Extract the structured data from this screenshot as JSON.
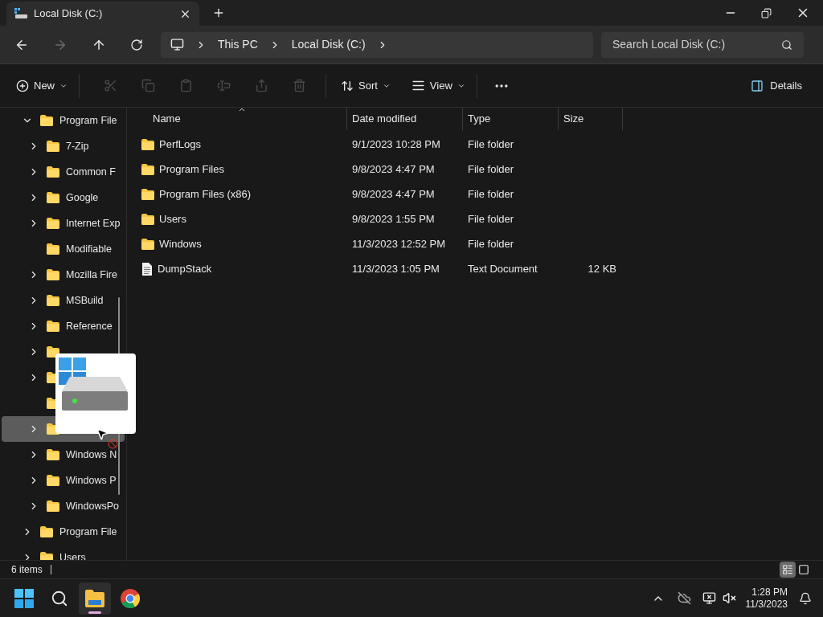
{
  "window": {
    "tabs": [
      {
        "title": "Local Disk (C:)",
        "selected": true
      }
    ]
  },
  "address": {
    "crumbs": [
      "This PC",
      "Local Disk (C:)"
    ]
  },
  "search": {
    "placeholder": "Search Local Disk (C:)"
  },
  "toolbar": {
    "new_label": "New",
    "actions": [
      {
        "disabled": true
      },
      {
        "disabled": true
      },
      {
        "disabled": true
      },
      {
        "disabled": true
      },
      {
        "disabled": true
      },
      {
        "disabled": true
      }
    ],
    "sort_label": "Sort",
    "view_label": "View",
    "details_label": "Details"
  },
  "tree": [
    {
      "label": "Program File",
      "expandable": true,
      "expanded": true,
      "selected": false,
      "children": [
        {
          "label": "7-Zip",
          "expandable": true,
          "expanded": false,
          "selected": false
        },
        {
          "label": "Common F",
          "expandable": true,
          "expanded": false,
          "selected": false
        },
        {
          "label": "Google",
          "expandable": true,
          "expanded": false,
          "selected": false
        },
        {
          "label": "Internet Exp",
          "expandable": true,
          "expanded": false,
          "selected": false
        },
        {
          "label": "Modifiable",
          "expandable": false,
          "expanded": false,
          "selected": false
        },
        {
          "label": "Mozilla Fire",
          "expandable": true,
          "expanded": false,
          "selected": false
        },
        {
          "label": "MSBuild",
          "expandable": true,
          "expanded": false,
          "selected": false
        },
        {
          "label": "Reference",
          "expandable": true,
          "expanded": false,
          "selected": false
        },
        {
          "expandable": true,
          "expanded": false,
          "selected": false
        },
        {
          "expandable": true,
          "expanded": false,
          "selected": false
        },
        {
          "expandable": false,
          "expanded": false,
          "selected": false
        },
        {
          "expandable": true,
          "expanded": false,
          "selected": true
        },
        {
          "label": "Windows N",
          "expandable": true,
          "expanded": false,
          "selected": false
        },
        {
          "label": "Windows P",
          "expandable": true,
          "expanded": false,
          "selected": false
        },
        {
          "label": "WindowsPo",
          "expandable": true,
          "expanded": false,
          "selected": false
        }
      ]
    },
    {
      "label": "Program File",
      "expandable": true,
      "expanded": false,
      "selected": false
    },
    {
      "label": "Users",
      "expandable": true,
      "expanded": false,
      "selected": false
    }
  ],
  "table": {
    "columns": [
      {
        "label": "Name",
        "sorted": true
      },
      {
        "label": "Date modified",
        "sorted": false
      },
      {
        "label": "Type",
        "sorted": false
      },
      {
        "label": "Size",
        "sorted": false
      }
    ],
    "rows": [
      {
        "kind": "folder",
        "name": "PerfLogs",
        "date": "9/1/2023 10:28 PM",
        "type": "File folder"
      },
      {
        "kind": "folder",
        "name": "Program Files",
        "date": "9/8/2023 4:47 PM",
        "type": "File folder"
      },
      {
        "kind": "folder",
        "name": "Program Files (x86)",
        "date": "9/8/2023 4:47 PM",
        "type": "File folder"
      },
      {
        "kind": "folder",
        "name": "Users",
        "date": "9/8/2023 1:55 PM",
        "type": "File folder"
      },
      {
        "kind": "folder",
        "name": "Windows",
        "date": "11/3/2023 12:52 PM",
        "type": "File folder"
      },
      {
        "kind": "file",
        "name": "DumpStack",
        "date": "11/3/2023 1:05 PM",
        "type": "Text Document",
        "size": "12 KB"
      }
    ]
  },
  "status_bar": {
    "count": "6 items",
    "views": [
      {
        "kind": "details",
        "selected": true
      },
      {
        "kind": "tiles",
        "selected": false
      }
    ]
  },
  "taskbar": {
    "apps": [
      {
        "kind": "start",
        "selected": false
      },
      {
        "kind": "search",
        "selected": false
      },
      {
        "kind": "explorer",
        "selected": true
      },
      {
        "kind": "browser",
        "selected": false
      }
    ],
    "time": "1:28 PM",
    "date": "11/3/2023"
  }
}
